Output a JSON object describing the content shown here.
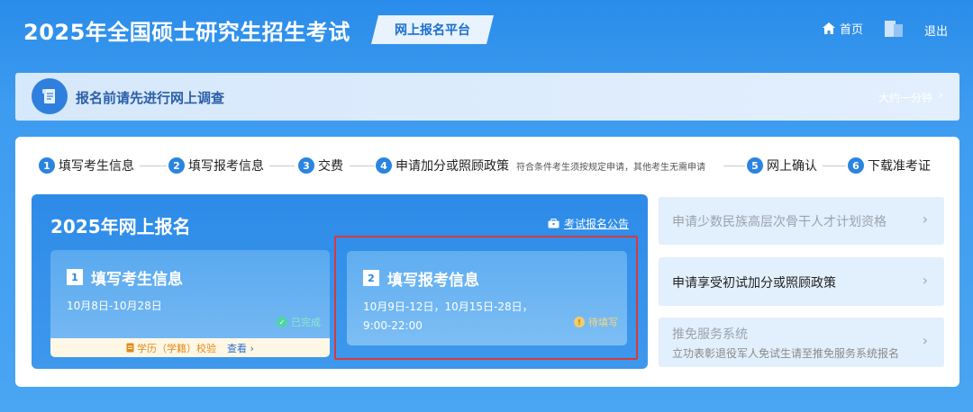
{
  "header": {
    "title": "2025年全国硕士研究生招生考试",
    "platform": "网上报名平台",
    "home_label": "首页",
    "logout_label": "退出"
  },
  "survey": {
    "text": "报名前请先进行网上调查",
    "time": "大约一分钟",
    "chevron": "›"
  },
  "steps": [
    {
      "num": "1",
      "label": "填写考生信息"
    },
    {
      "num": "2",
      "label": "填写报考信息"
    },
    {
      "num": "3",
      "label": "交费"
    },
    {
      "num": "4",
      "label": "申请加分或照顾政策",
      "note": "符合条件考生须按规定申请，其他考生无需申请"
    },
    {
      "num": "5",
      "label": "网上确认"
    },
    {
      "num": "6",
      "label": "下载准考证"
    }
  ],
  "registration": {
    "title": "2025年网上报名",
    "notice_link": "考试报名公告",
    "card1": {
      "num": "1",
      "title": "填写考生信息",
      "date": "10月8日-10月28日",
      "status": "已完成",
      "verify_label": "学历（学籍）校验",
      "view_label": "查看 ›"
    },
    "card2": {
      "num": "2",
      "title": "填写报考信息",
      "date_line1": "10月9日-12日，10月15日-28日，",
      "date_line2": "9:00-22:00",
      "status": "待填写"
    }
  },
  "side_list": [
    {
      "title": "申请少数民族高层次骨干人才计划资格",
      "subtitle": ""
    },
    {
      "title": "申请享受初试加分或照顾政策",
      "subtitle": ""
    },
    {
      "title": "推免服务系统",
      "subtitle": "立功表彰退役军人免试生请至推免服务系统报名"
    }
  ],
  "colors": {
    "primary": "#2a84e0",
    "highlight_border": "#d83a3a",
    "done_green": "#4ed5a2",
    "pending_yellow": "#f3cc6a"
  },
  "icons": {
    "home": "home-icon",
    "survey": "scroll-icon",
    "notice": "briefcase-icon",
    "done": "check-circle-icon",
    "pending": "exclamation-circle-icon",
    "verify": "document-icon"
  }
}
